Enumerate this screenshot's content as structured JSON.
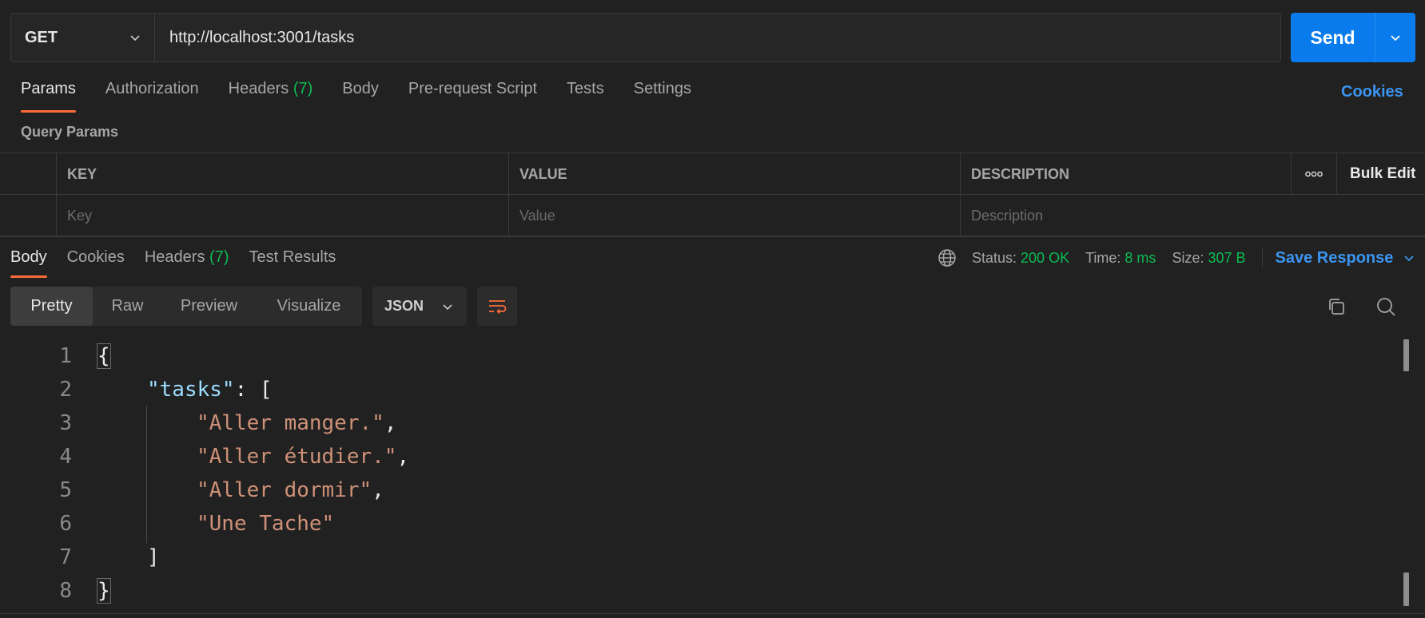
{
  "request": {
    "method": "GET",
    "url": "http://localhost:3001/tasks",
    "send_label": "Send"
  },
  "request_tabs": [
    {
      "label": "Params",
      "active": true
    },
    {
      "label": "Authorization"
    },
    {
      "label": "Headers",
      "count": "(7)"
    },
    {
      "label": "Body"
    },
    {
      "label": "Pre-request Script"
    },
    {
      "label": "Tests"
    },
    {
      "label": "Settings"
    }
  ],
  "cookies_link": "Cookies",
  "query_params": {
    "title": "Query Params",
    "columns": [
      "KEY",
      "VALUE",
      "DESCRIPTION"
    ],
    "more_icon": "ooo",
    "bulk_edit": "Bulk Edit",
    "placeholders": [
      "Key",
      "Value",
      "Description"
    ]
  },
  "response_tabs": [
    {
      "label": "Body",
      "active": true
    },
    {
      "label": "Cookies"
    },
    {
      "label": "Headers",
      "count": "(7)"
    },
    {
      "label": "Test Results"
    }
  ],
  "response_meta": {
    "status_label": "Status:",
    "status_value": "200 OK",
    "time_label": "Time:",
    "time_value": "8 ms",
    "size_label": "Size:",
    "size_value": "307 B",
    "save_label": "Save Response"
  },
  "view_modes": [
    "Pretty",
    "Raw",
    "Preview",
    "Visualize"
  ],
  "language": "JSON",
  "code_lines": [
    {
      "num": "1"
    },
    {
      "num": "2"
    },
    {
      "num": "3"
    },
    {
      "num": "4"
    },
    {
      "num": "5"
    },
    {
      "num": "6"
    },
    {
      "num": "7"
    },
    {
      "num": "8"
    }
  ],
  "code": {
    "open_brace": "{",
    "key": "\"tasks\"",
    "colon_bracket": ": [",
    "items": [
      "\"Aller manger.\"",
      "\"Aller étudier.\"",
      "\"Aller dormir\"",
      "\"Une Tache\""
    ],
    "comma": ",",
    "close_bracket": "]",
    "close_brace": "}"
  },
  "colors": {
    "accent_orange": "#ff6c37",
    "send_blue": "#097bed",
    "link_blue": "#3b94f0",
    "status_green": "#0cbb52",
    "json_key": "#9cdcfe",
    "json_string": "#ce9178"
  },
  "icons": [
    "chevron-down-icon",
    "globe-icon",
    "wrap-lines-icon",
    "copy-icon",
    "search-icon",
    "more-horizontal-icon"
  ]
}
